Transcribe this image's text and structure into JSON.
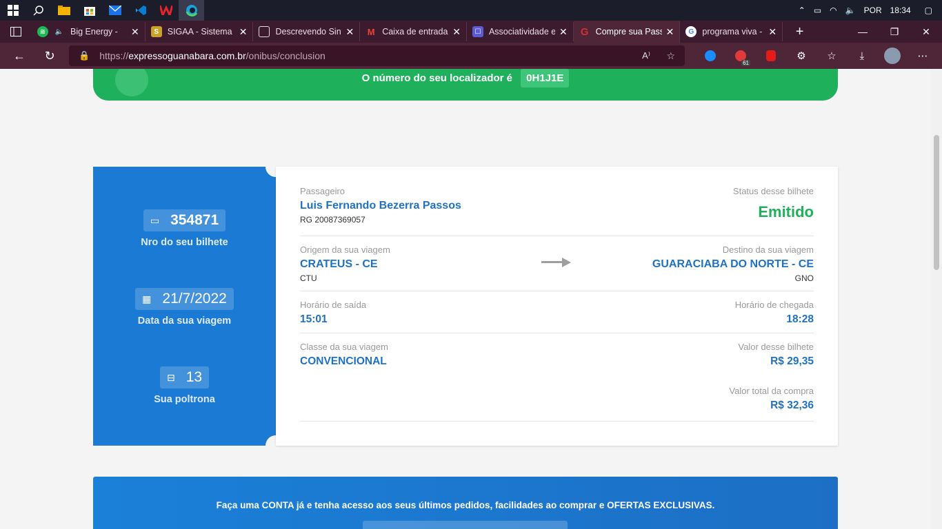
{
  "taskbar": {
    "language": "POR",
    "clock": "18:34",
    "icons": [
      "windows-start-icon",
      "search-icon",
      "file-explorer-icon",
      "store-icon",
      "mail-icon",
      "vscode-icon",
      "wps-icon",
      "edge-icon"
    ]
  },
  "tabs": [
    {
      "label": "Big Energy -",
      "favicon": "spotify-icon",
      "color": "#1db954"
    },
    {
      "label": "SIGAA - Sistema I",
      "favicon": "sigaa-icon",
      "color": "#c9a227"
    },
    {
      "label": "Descrevendo Sint",
      "favicon": "document-icon",
      "color": "#888888"
    },
    {
      "label": "Caixa de entrada",
      "favicon": "gmail-icon",
      "color": "#ea4335"
    },
    {
      "label": "Associatividade e",
      "favicon": "associatividade-icon",
      "color": "#5b5bd6"
    },
    {
      "label": "Compre sua Pass",
      "favicon": "guanabara-icon",
      "color": "#d32f2f"
    },
    {
      "label": "programa viva - P",
      "favicon": "google-icon",
      "color": "#4285f4"
    }
  ],
  "address_bar": {
    "scheme": "https://",
    "host": "expressoguanabara.com.br",
    "path": "/onibus/conclusion",
    "extension_badge": "61"
  },
  "banner": {
    "locator_text": "O número do seu localizador é",
    "locator_code": "0H1J1E"
  },
  "ticket": {
    "number": "354871",
    "number_caption": "Nro do seu bilhete",
    "date": "21/7/2022",
    "date_caption": "Data da sua viagem",
    "seat": "13",
    "seat_caption": "Sua poltrona",
    "passenger_label": "Passageiro",
    "passenger_name": "Luis Fernando Bezerra Passos",
    "passenger_doc": "RG 20087369057",
    "status_label": "Status desse bilhete",
    "status_value": "Emitido",
    "origin_label": "Origem da sua viagem",
    "origin_city": "CRATEUS - CE",
    "origin_code": "CTU",
    "destination_label": "Destino da sua viagem",
    "destination_city": "GUARACIABA DO NORTE - CE",
    "destination_code": "GNO",
    "departure_label": "Horário de saída",
    "departure_time": "15:01",
    "arrival_label": "Horário de chegada",
    "arrival_time": "18:28",
    "class_label": "Classe da sua viagem",
    "class_value": "CONVENCIONAL",
    "price_label": "Valor desse bilhete",
    "price_value": "R$ 29,35",
    "total_label": "Valor total da compra",
    "total_value": "R$ 32,36"
  },
  "promo": {
    "text": "Faça uma CONTA já e tenha acesso aos seus últimos pedidos, facilidades ao comprar e OFERTAS EXCLUSIVAS."
  },
  "colors": {
    "brand_blue": "#1b7ad3",
    "status_green": "#1eb05a",
    "browser_frame": "#4e2638"
  }
}
